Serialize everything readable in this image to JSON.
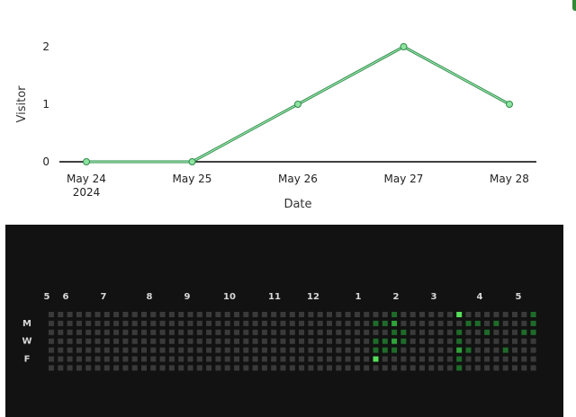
{
  "chart_data": [
    {
      "type": "line",
      "x": [
        "May 24",
        "May 25",
        "May 26",
        "May 27",
        "May 28"
      ],
      "x_sublabels": [
        "2024",
        "",
        "",
        "",
        ""
      ],
      "values": [
        0,
        0,
        1,
        2,
        1
      ],
      "xlabel": "Date",
      "ylabel": "Visitor",
      "ylim": [
        0,
        2
      ],
      "yticks": [
        0,
        1,
        2
      ],
      "grid": false,
      "colors": {
        "line": "#2e8b4a",
        "marker": "#8fe3a0"
      }
    },
    {
      "type": "heatmap",
      "month_labels": [
        "5",
        "6",
        "7",
        "8",
        "9",
        "10",
        "11",
        "12",
        "1",
        "2",
        "3",
        "4",
        "5"
      ],
      "day_labels": [
        "M",
        "W",
        "F"
      ],
      "rows": 7,
      "weeks": 53,
      "active_cells": [
        {
          "week": 35,
          "day": 1,
          "level": 1
        },
        {
          "week": 35,
          "day": 3,
          "level": 1
        },
        {
          "week": 35,
          "day": 4,
          "level": 1
        },
        {
          "week": 35,
          "day": 5,
          "level": 3
        },
        {
          "week": 36,
          "day": 1,
          "level": 1
        },
        {
          "week": 36,
          "day": 3,
          "level": 1
        },
        {
          "week": 36,
          "day": 4,
          "level": 1
        },
        {
          "week": 37,
          "day": 0,
          "level": 1
        },
        {
          "week": 37,
          "day": 1,
          "level": 2
        },
        {
          "week": 37,
          "day": 2,
          "level": 1
        },
        {
          "week": 37,
          "day": 3,
          "level": 2
        },
        {
          "week": 37,
          "day": 4,
          "level": 1
        },
        {
          "week": 38,
          "day": 2,
          "level": 1
        },
        {
          "week": 38,
          "day": 3,
          "level": 1
        },
        {
          "week": 44,
          "day": 0,
          "level": 3
        },
        {
          "week": 44,
          "day": 2,
          "level": 1
        },
        {
          "week": 44,
          "day": 3,
          "level": 1
        },
        {
          "week": 44,
          "day": 4,
          "level": 2
        },
        {
          "week": 44,
          "day": 5,
          "level": 1
        },
        {
          "week": 44,
          "day": 6,
          "level": 1
        },
        {
          "week": 45,
          "day": 1,
          "level": 1
        },
        {
          "week": 45,
          "day": 4,
          "level": 1
        },
        {
          "week": 46,
          "day": 1,
          "level": 1
        },
        {
          "week": 47,
          "day": 2,
          "level": 1
        },
        {
          "week": 48,
          "day": 1,
          "level": 1
        },
        {
          "week": 49,
          "day": 4,
          "level": 1
        },
        {
          "week": 51,
          "day": 2,
          "level": 1
        },
        {
          "week": 52,
          "day": 0,
          "level": 1
        },
        {
          "week": 52,
          "day": 1,
          "level": 1
        },
        {
          "week": 52,
          "day": 2,
          "level": 1
        }
      ],
      "colors": {
        "background": "#121212",
        "empty": "#3a3a3a",
        "level1": "#1f6b2a",
        "level2": "#2fa33a",
        "level3": "#55e05a"
      }
    }
  ]
}
